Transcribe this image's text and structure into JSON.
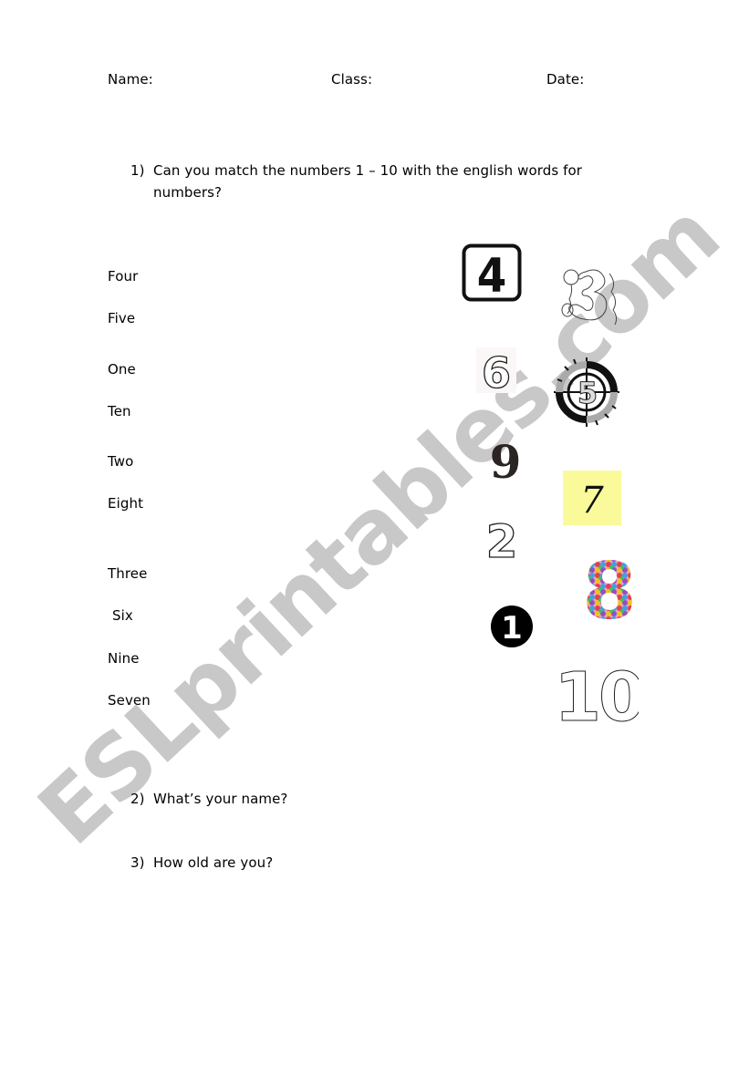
{
  "header": {
    "name_label": "Name:",
    "class_label": "Class:",
    "date_label": "Date:"
  },
  "questions": [
    {
      "number": "1)",
      "text_line1": "Can you match the numbers 1 – 10 with the english words for",
      "text_line2": "numbers?"
    },
    {
      "number": "2)",
      "text": "What’s your name?"
    },
    {
      "number": "3)",
      "text": "How old are you?"
    }
  ],
  "words": [
    "Four",
    "Five",
    "One",
    "Ten",
    "Two",
    "Eight",
    "Three",
    "Six",
    "Nine",
    "Seven"
  ],
  "number_pictures": [
    {
      "value": "4",
      "style": "black digit in rounded square frame"
    },
    {
      "value": "3",
      "style": "balloon outline drawing"
    },
    {
      "value": "6",
      "style": "outlined bubble digit"
    },
    {
      "value": "5",
      "style": "target crosshair emblem"
    },
    {
      "value": "9",
      "style": "black serif digit"
    },
    {
      "value": "7",
      "style": "handwritten on yellow note"
    },
    {
      "value": "2",
      "style": "outlined bubble digit"
    },
    {
      "value": "8",
      "style": "colorful dotted digit"
    },
    {
      "value": "1",
      "style": "white digit in black circle"
    },
    {
      "value": "10",
      "style": "outlined digits"
    }
  ],
  "colors": {
    "watermark": "#c4c4c4",
    "sticky_note": "#fafa9a"
  },
  "watermark": "ESLprintables.com"
}
